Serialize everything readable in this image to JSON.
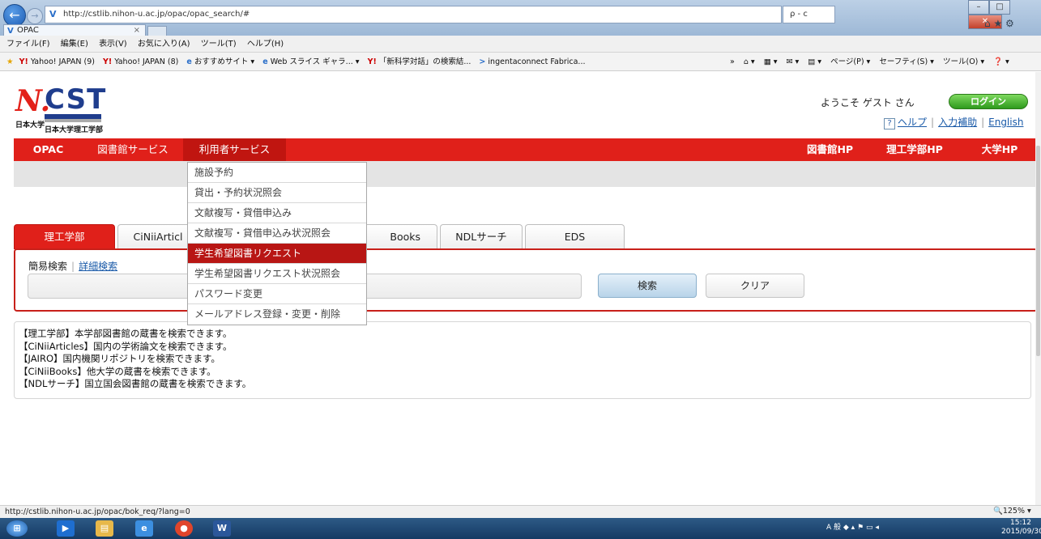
{
  "browser": {
    "url": "http://cstlib.nihon-u.ac.jp/opac/opac_search/#",
    "url_controls": "ρ - c",
    "tab_title": "OPAC",
    "tab_close": "×",
    "menu": [
      "ファイル(F)",
      "編集(E)",
      "表示(V)",
      "お気に入り(A)",
      "ツール(T)",
      "ヘルプ(H)"
    ],
    "favorites": [
      {
        "icon": "Y!",
        "label": "Yahoo! JAPAN (9)"
      },
      {
        "icon": "Y!",
        "label": "Yahoo! JAPAN (8)"
      },
      {
        "icon": "e",
        "label": "おすすめサイト ▾"
      },
      {
        "icon": "e",
        "label": "Web スライス ギャラ... ▾"
      },
      {
        "icon": "Y!",
        "label": "「新科学対話」の検索結..."
      },
      {
        "icon": ">",
        "label": "ingentaconnect Fabrica..."
      }
    ],
    "commands": [
      "»",
      "⌂ ▾",
      "▦ ▾",
      "✉ ▾",
      "▤ ▾",
      "ページ(P) ▾",
      "セーフティ(S) ▾",
      "ツール(O) ▾",
      "❓ ▾"
    ],
    "status_url": "http://cstlib.nihon-u.ac.jp/opac/bok_req/?lang=0",
    "zoom": "125%"
  },
  "header": {
    "logo_mark": "N.",
    "logo_text": "CST",
    "univ_short": "日本大学",
    "univ_name": "日本大学理工学部",
    "welcome": "ようこそ ゲスト さん",
    "login": "ログイン",
    "help_icon": "?",
    "help": "ヘルプ",
    "input_help": "入力補助",
    "english": "English"
  },
  "nav": {
    "left": [
      "OPAC",
      "図書館サービス",
      "利用者サービス"
    ],
    "right": [
      "図書館HP",
      "理工学部HP",
      "大学HP"
    ]
  },
  "dropdown": [
    "施設予約",
    "貸出・予約状況照会",
    "文献複写・貸借申込み",
    "文献複写・貸借申込み状況照会",
    "学生希望図書リクエスト",
    "学生希望図書リクエスト状況照会",
    "パスワード変更",
    "メールアドレス登録・変更・削除"
  ],
  "search": {
    "tabs": [
      "理工学部",
      "CiNiiArticl",
      "Books",
      "NDLサーチ",
      "EDS"
    ],
    "mode_simple": "簡易検索",
    "mode_detail": "詳細検索",
    "search_btn": "検索",
    "clear_btn": "クリア"
  },
  "info_lines": [
    "【理工学部】本学部図書館の蔵書を検索できます。",
    "【CiNiiArticles】国内の学術論文を検索できます。",
    "【JAIRO】国内機関リポジトリを検索できます。",
    "【CiNiiBooks】他大学の蔵書を検索できます。",
    "【NDLサーチ】国立国会図書館の蔵書を検索できます。"
  ],
  "taskbar": {
    "time": "15:12",
    "date": "2015/09/30",
    "tray": "A 般"
  },
  "colors": {
    "nav_red": "#e0201a",
    "highlight_red": "#b81614",
    "logo_blue": "#1f3d8d",
    "login_green": "#3aa72a"
  }
}
